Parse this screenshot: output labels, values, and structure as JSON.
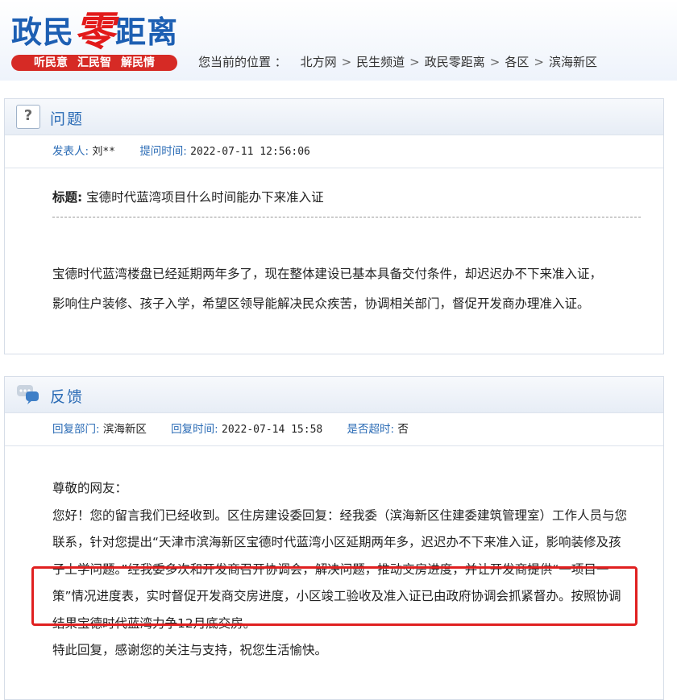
{
  "header": {
    "logo": {
      "part1": "政民",
      "part2": "零",
      "part3": "距离"
    },
    "slogans": [
      "听民意",
      "汇民智",
      "解民情"
    ],
    "breadcrumb_label": "您当前的位置 ：",
    "breadcrumb": [
      "北方网",
      "民生频道",
      "政民零距离",
      "各区",
      "滨海新区"
    ]
  },
  "question": {
    "section_title": "问题",
    "icon_glyph": "?",
    "poster_label": "发表人:",
    "poster": "刘**",
    "time_label": "提问时间:",
    "time": "2022-07-11 12:56:06",
    "title_label": "标题:",
    "title": "宝德时代蓝湾项目什么时间能办下来准入证",
    "content": "宝德时代蓝湾楼盘已经延期两年多了，现在整体建设已基本具备交付条件，却迟迟办不下来准入证，影响住户装修、孩子入学，希望区领导能解决民众疾苦，协调相关部门，督促开发商办理准入证。"
  },
  "feedback": {
    "section_title": "反馈",
    "dept_label": "回复部门:",
    "dept": "滨海新区",
    "time_label": "回复时间:",
    "time": "2022-07-14 15:58",
    "overdue_label": "是否超时:",
    "overdue": "否",
    "greeting": "尊敬的网友：",
    "paragraph": "您好！您的留言我们已经收到。区住房建设委回复：经我委（滨海新区住建委建筑管理室）工作人员与您联系，针对您提出“天津市滨海新区宝德时代蓝湾小区延期两年多，迟迟办不下来准入证，影响装修及孩子上学问题。”经我委多次和开发商召开协调会，解决问题，推动交房进度，并让开发商提供“一项目一策”情况进度表，实时督促开发商交房进度，小区竣工验收及准入证已由政府协调会抓紧督办。按照协调结果宝德时代蓝湾力争12月底交房。",
    "closing": "特此回复，感谢您的关注与支持，祝您生活愉快。"
  },
  "colors": {
    "accent": "#2a6bb5",
    "logo_blue": "#1d5fb3",
    "logo_red": "#e21a1a",
    "slogan_bg": "#d62a25",
    "highlight": "#e02020"
  }
}
